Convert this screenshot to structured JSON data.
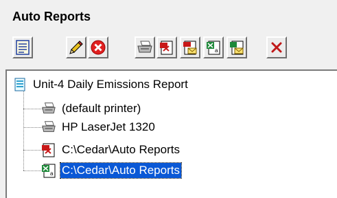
{
  "panel": {
    "title": "Auto Reports"
  },
  "toolbar": {
    "buttons": [
      {
        "icon": "report-list-icon"
      },
      {
        "icon": "pencil-edit-icon"
      },
      {
        "icon": "delete-red-x-icon"
      },
      {
        "icon": "printer-icon"
      },
      {
        "icon": "pdf-file-icon"
      },
      {
        "icon": "pdf-email-icon"
      },
      {
        "icon": "excel-file-icon"
      },
      {
        "icon": "excel-email-icon"
      },
      {
        "icon": "remove-x-icon"
      }
    ]
  },
  "tree": {
    "root": {
      "label": "Unit-4 Daily Emissions Report",
      "icon": "report-document-icon"
    },
    "children": [
      {
        "label": "(default printer)",
        "icon": "printer-icon",
        "selected": false
      },
      {
        "label": "HP LaserJet 1320",
        "icon": "printer-icon",
        "selected": false
      },
      {
        "label": "C:\\Cedar\\Auto Reports",
        "icon": "pdf-file-icon",
        "selected": false
      },
      {
        "label": "C:\\Cedar\\Auto Reports",
        "icon": "excel-file-icon",
        "selected": true
      }
    ]
  },
  "colors": {
    "selection": "#0a58d6",
    "delete_red": "#e02020",
    "pdf_red": "#c81818",
    "excel_green": "#1e8a3a"
  }
}
